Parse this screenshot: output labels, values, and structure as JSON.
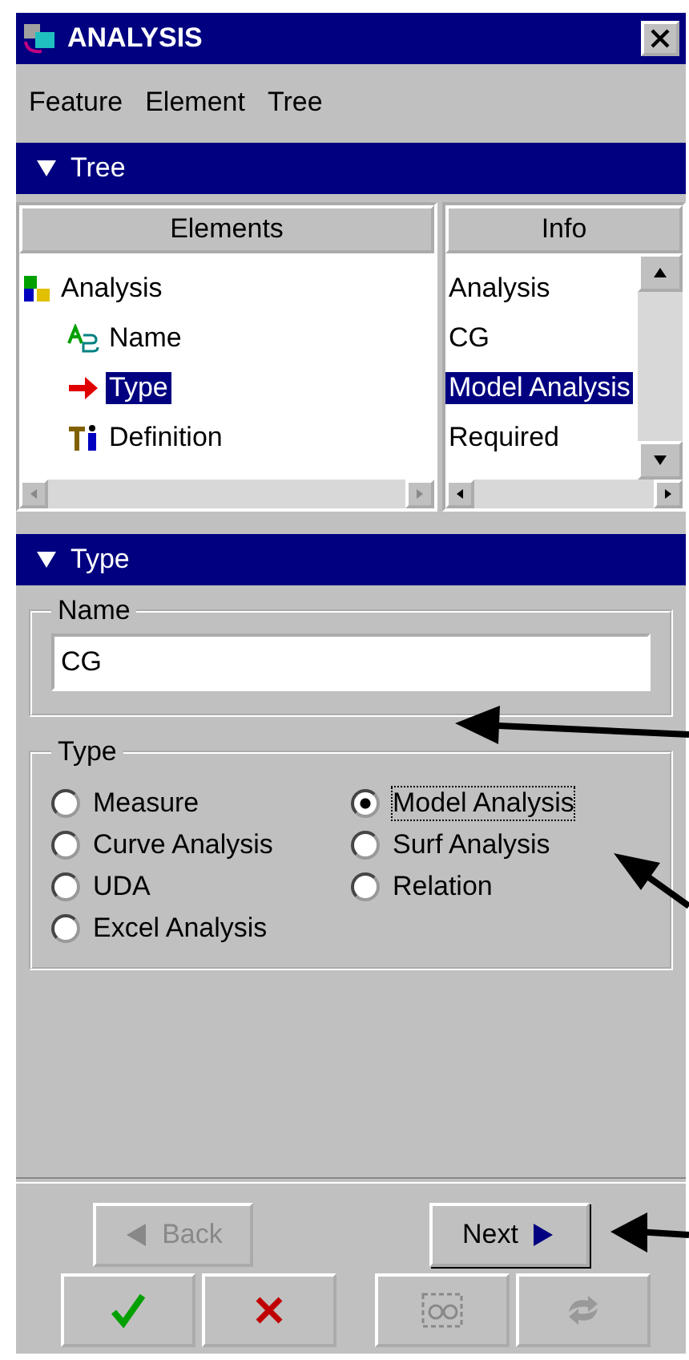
{
  "window": {
    "title": "ANALYSIS"
  },
  "menu": [
    "Feature",
    "Element",
    "Tree"
  ],
  "tree_panel": {
    "header": "Tree",
    "columns": [
      "Elements",
      "Info"
    ],
    "elements": [
      {
        "label": "Analysis",
        "kind": "analysis",
        "selected": false,
        "children": [
          {
            "label": "Name",
            "kind": "name",
            "selected": false
          },
          {
            "label": "Type",
            "kind": "arrow",
            "selected": true
          },
          {
            "label": "Definition",
            "kind": "definition",
            "selected": false
          }
        ]
      }
    ],
    "info": [
      {
        "text": "Analysis",
        "selected": false
      },
      {
        "text": "CG",
        "selected": false
      },
      {
        "text": "Model Analysis",
        "selected": true
      },
      {
        "text": "Required",
        "selected": false
      }
    ]
  },
  "type_panel": {
    "header": "Type",
    "name_group": {
      "legend": "Name",
      "value": "CG"
    },
    "type_group": {
      "legend": "Type",
      "options": [
        {
          "label": "Measure",
          "selected": false
        },
        {
          "label": "Model Analysis",
          "selected": true
        },
        {
          "label": "Curve Analysis",
          "selected": false
        },
        {
          "label": "Surf Analysis",
          "selected": false
        },
        {
          "label": "UDA",
          "selected": false
        },
        {
          "label": "Relation",
          "selected": false
        },
        {
          "label": "Excel Analysis",
          "selected": false
        }
      ]
    }
  },
  "nav_buttons": [
    {
      "label": "Back",
      "kind": "back",
      "disabled": true
    },
    {
      "label": "Next",
      "kind": "next",
      "disabled": false
    }
  ],
  "action_buttons": [
    {
      "kind": "ok",
      "disabled": false
    },
    {
      "kind": "cancel",
      "disabled": false
    },
    {
      "kind": "preview",
      "disabled": true
    },
    {
      "kind": "repeat",
      "disabled": true
    }
  ]
}
